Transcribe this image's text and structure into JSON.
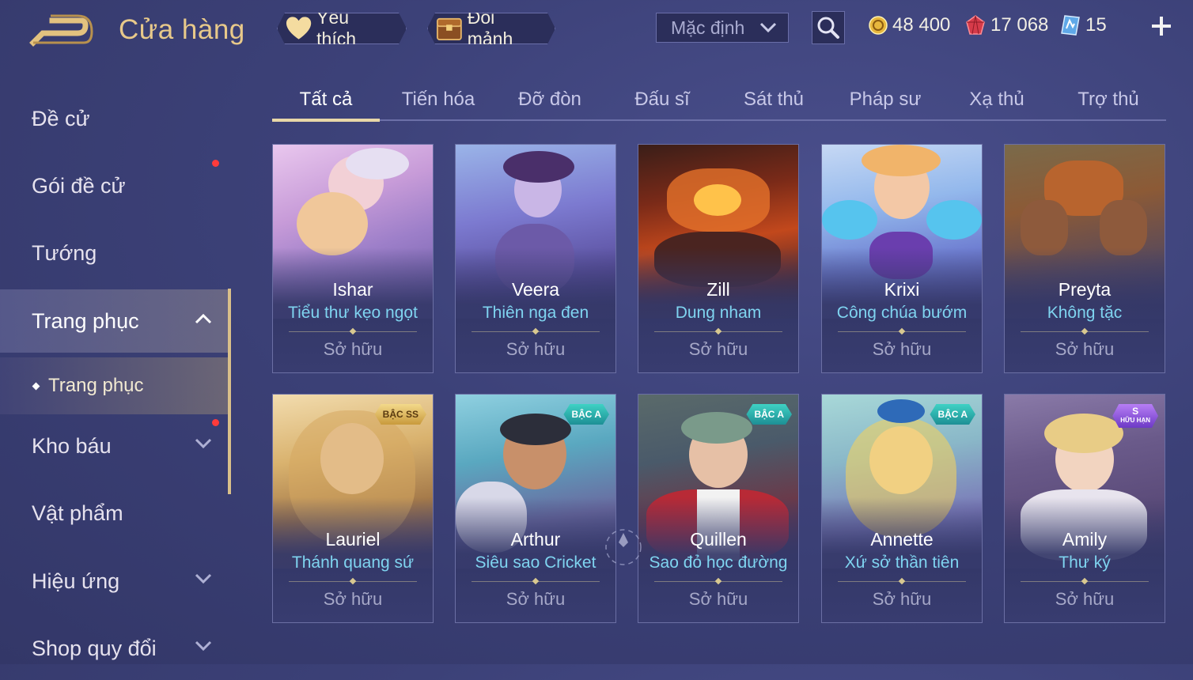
{
  "header": {
    "title": "Cửa hàng",
    "favorites_label": "Yêu thích",
    "exchange_label": "Đổi mảnh",
    "sort": {
      "selected": "Mặc định"
    },
    "currencies": [
      {
        "icon": "gold-coin-icon",
        "amount": "48 400"
      },
      {
        "icon": "ruby-gem-icon",
        "amount": "17 068"
      },
      {
        "icon": "voucher-icon",
        "amount": "15"
      }
    ]
  },
  "sidebar": {
    "items": [
      {
        "label": "Đề cử"
      },
      {
        "label": "Gói đề cử"
      },
      {
        "label": "Tướng"
      },
      {
        "label": "Trang phục"
      },
      {
        "label": "Kho báu"
      },
      {
        "label": "Vật phẩm"
      },
      {
        "label": "Hiệu ứng"
      },
      {
        "label": "Shop quy đổi"
      }
    ],
    "sub_item": "Trang phục"
  },
  "tabs": [
    "Tất cả",
    "Tiến hóa",
    "Đỡ đòn",
    "Đấu sĩ",
    "Sát thủ",
    "Pháp sư",
    "Xạ thủ",
    "Trợ thủ"
  ],
  "cards": [
    {
      "hero": "Ishar",
      "skin": "Tiểu thư kẹo ngọt",
      "status": "Sở hữu"
    },
    {
      "hero": "Veera",
      "skin": "Thiên nga đen",
      "status": "Sở hữu"
    },
    {
      "hero": "Zill",
      "skin": "Dung nham",
      "status": "Sở hữu"
    },
    {
      "hero": "Krixi",
      "skin": "Công chúa bướm",
      "status": "Sở hữu"
    },
    {
      "hero": "Preyta",
      "skin": "Không tặc",
      "status": "Sở hữu"
    },
    {
      "hero": "Lauriel",
      "skin": "Thánh quang sứ",
      "status": "Sở hữu",
      "badge": "BẬC SS"
    },
    {
      "hero": "Arthur",
      "skin": "Siêu sao Cricket",
      "status": "Sở hữu",
      "badge": "BẬC A"
    },
    {
      "hero": "Quillen",
      "skin": "Sao đỏ học đường",
      "status": "Sở hữu",
      "badge": "BẬC A"
    },
    {
      "hero": "Annette",
      "skin": "Xứ sở thần tiên",
      "status": "Sở hữu",
      "badge": "BẬC A"
    },
    {
      "hero": "Amily",
      "skin": "Thư ký",
      "status": "Sở hữu",
      "badge_top": "S",
      "badge_bottom": "HỮU HẠN"
    }
  ],
  "colors": {
    "gold_accent": "#e8c98a",
    "skin_name": "#7fd4f0",
    "badge_ss": "#d9b45c",
    "badge_a": "#2bb3ad",
    "badge_limited": "#9a5ce6",
    "notification": "#ff3b3b"
  }
}
